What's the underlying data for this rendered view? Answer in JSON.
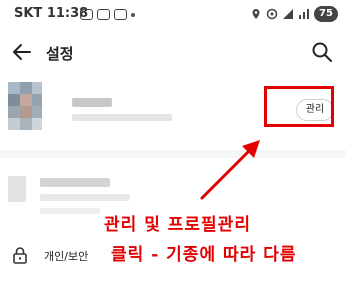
{
  "status_bar": {
    "carrier": "SKT",
    "time": "11:38",
    "battery": "75"
  },
  "header": {
    "title": "설정",
    "back_icon": "arrow-left-icon",
    "search_icon": "search-icon"
  },
  "profile": {
    "manage_label": "관리"
  },
  "annotation": {
    "line1": "관리 및 프로필관리",
    "line2": "클릭 - 기종에 따라 다름",
    "color": "#e30000"
  },
  "privacy": {
    "label": "개인/보안"
  }
}
